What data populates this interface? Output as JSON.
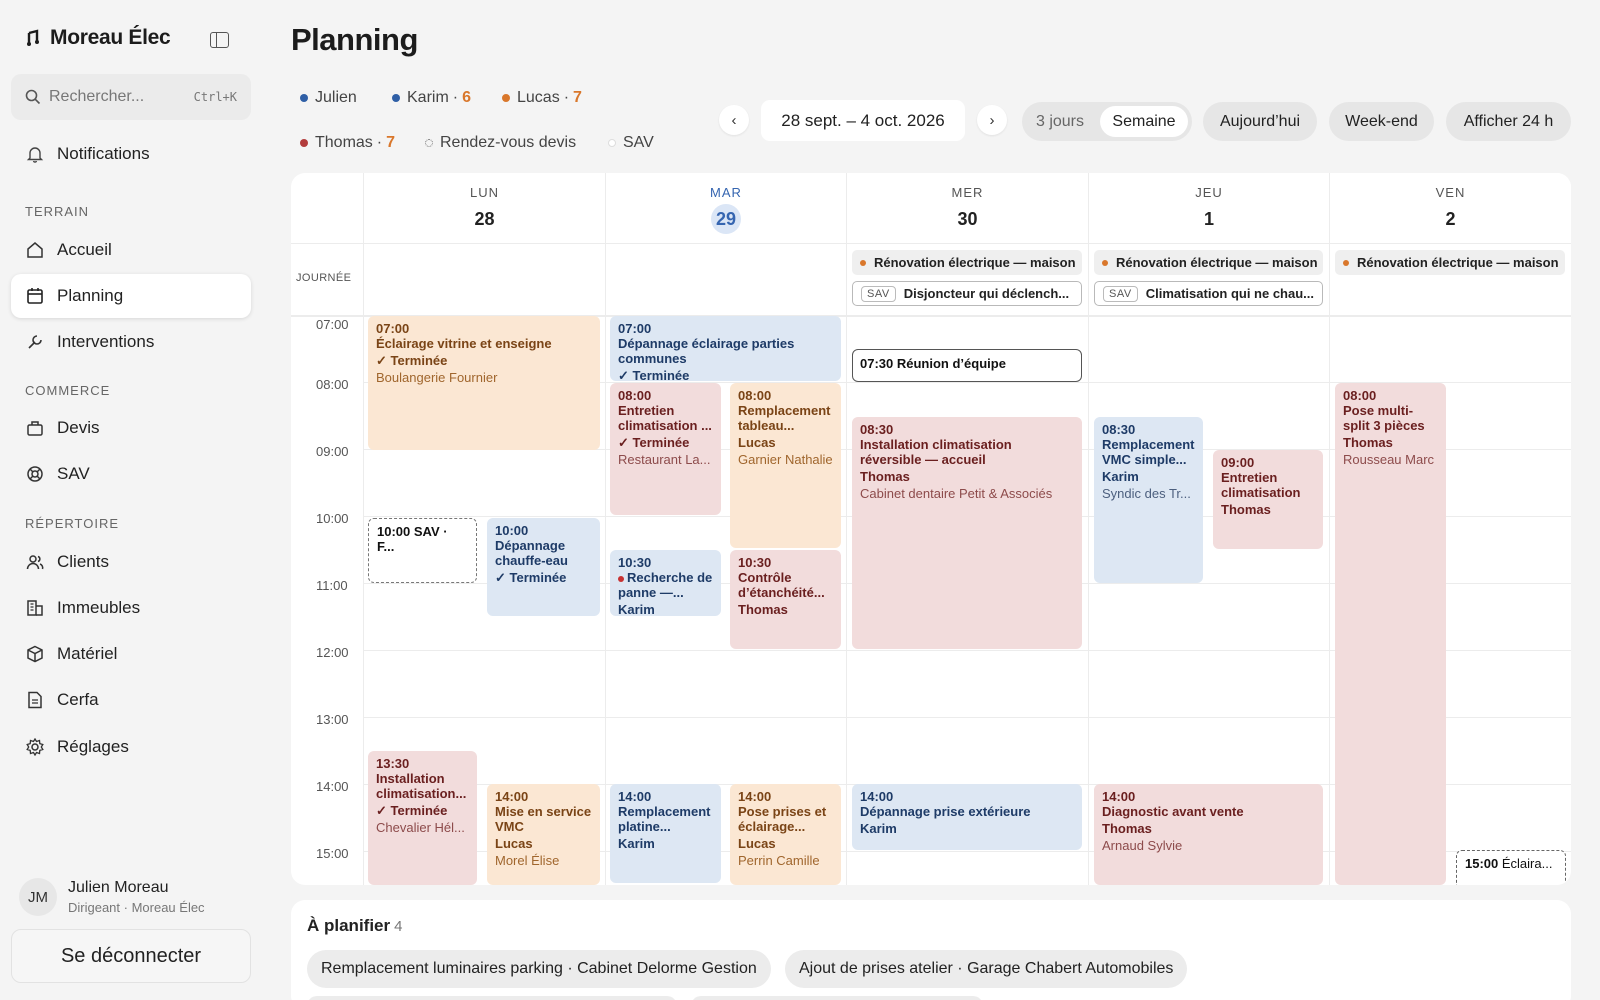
{
  "app": {
    "brand": "Moreau Élec"
  },
  "search": {
    "placeholder": "Rechercher...",
    "shortcut": "Ctrl+K"
  },
  "sidebar": {
    "notifications": "Notifications",
    "sections": {
      "terrain": "TERRAIN",
      "commerce": "COMMERCE",
      "repertoire": "RÉPERTOIRE"
    },
    "items": [
      {
        "label": "Accueil",
        "icon": "home-icon"
      },
      {
        "label": "Planning",
        "icon": "calendar-icon",
        "active": true
      },
      {
        "label": "Interventions",
        "icon": "wrench-icon"
      },
      {
        "label": "Devis",
        "icon": "briefcase-icon"
      },
      {
        "label": "SAV",
        "icon": "lifebuoy-icon"
      },
      {
        "label": "Clients",
        "icon": "users-icon"
      },
      {
        "label": "Immeubles",
        "icon": "building-icon"
      },
      {
        "label": "Matériel",
        "icon": "box-icon"
      },
      {
        "label": "Cerfa",
        "icon": "document-icon"
      },
      {
        "label": "Réglages",
        "icon": "gear-icon"
      }
    ]
  },
  "user": {
    "initials": "JM",
    "name": "Julien Moreau",
    "role": "Dirigeant · Moreau Élec",
    "logout": "Se déconnecter"
  },
  "header": {
    "title": "Planning"
  },
  "legend": [
    {
      "name": "Julien",
      "count": "",
      "color": "#2f5fa6"
    },
    {
      "name": "Karim",
      "count": "6",
      "color": "#2f5fa6"
    },
    {
      "name": "Lucas",
      "count": "7",
      "color": "#d9772b"
    },
    {
      "name": "Thomas",
      "count": "7",
      "color": "#b23c3c"
    },
    {
      "name": "Rendez-vous devis",
      "count": ""
    },
    {
      "name": "SAV",
      "count": ""
    }
  ],
  "toolbar": {
    "prev": "‹",
    "next": "›",
    "range": "28 sept. – 4 oct. 2026",
    "view_3days": "3 jours",
    "view_week": "Semaine",
    "today": "Aujourd’hui",
    "weekend": "Week-end",
    "show24": "Afficher 24 h"
  },
  "calendar": {
    "journee_label": "JOURNÉE",
    "days": [
      {
        "dow": "LUN",
        "num": "28"
      },
      {
        "dow": "MAR",
        "num": "29",
        "today": true
      },
      {
        "dow": "MER",
        "num": "30"
      },
      {
        "dow": "JEU",
        "num": "1"
      },
      {
        "dow": "VEN",
        "num": "2"
      }
    ],
    "hours": [
      "07:00",
      "08:00",
      "09:00",
      "10:00",
      "11:00",
      "12:00",
      "13:00",
      "14:00",
      "15:00"
    ],
    "allday": {
      "renovation": "Rénovation électrique — maison",
      "sav_tag": "SAV",
      "sav_wed": "Disjoncteur qui déclench...",
      "sav_thu": "Climatisation qui ne chau..."
    },
    "events": {
      "e1": {
        "time": "07:00",
        "title": "Éclairage vitrine et enseigne",
        "status": "✓ Terminée",
        "client": "Boulangerie Fournier"
      },
      "e2": {
        "time": "10:00",
        "title": "SAV · F..."
      },
      "e3": {
        "time": "10:00",
        "title": "Dépannage chauffe-eau",
        "status": "✓ Terminée"
      },
      "e4": {
        "time": "13:30",
        "title": "Installation climatisation...",
        "status": "✓ Terminée",
        "client": "Chevalier Hél..."
      },
      "e5": {
        "time": "14:00",
        "title": "Mise en service VMC",
        "who": "Lucas",
        "client": "Morel Élise"
      },
      "e6": {
        "time": "07:00",
        "title": "Dépannage éclairage parties communes",
        "status": "✓ Terminée"
      },
      "e7": {
        "time": "08:00",
        "title": "Entretien climatisation ...",
        "status": "✓ Terminée",
        "client": "Restaurant La..."
      },
      "e8": {
        "time": "08:00",
        "title": "Remplacement tableau...",
        "who": "Lucas",
        "client": "Garnier Nathalie"
      },
      "e9": {
        "time": "10:30",
        "title": "Recherche de panne —...",
        "who": "Karim"
      },
      "e10": {
        "time": "10:30",
        "title": "Contrôle d’étanchéité...",
        "who": "Thomas"
      },
      "e11": {
        "time": "14:00",
        "title": "Remplacement platine...",
        "who": "Karim"
      },
      "e12": {
        "time": "14:00",
        "title": "Pose prises et éclairage...",
        "who": "Lucas",
        "client": "Perrin Camille"
      },
      "e13": {
        "time": "07:30",
        "title": "Réunion d’équipe"
      },
      "e14": {
        "time": "08:30",
        "title": "Installation climatisation réversible — accueil",
        "who": "Thomas",
        "client": "Cabinet dentaire Petit & Associés"
      },
      "e15": {
        "time": "14:00",
        "title": "Dépannage prise extérieure",
        "who": "Karim"
      },
      "e16": {
        "time": "08:30",
        "title": "Remplacement VMC simple...",
        "who": "Karim",
        "client": "Syndic des Tr..."
      },
      "e17": {
        "time": "09:00",
        "title": "Entretien climatisation",
        "who": "Thomas"
      },
      "e18": {
        "time": "14:00",
        "title": "Diagnostic avant vente",
        "who": "Thomas",
        "client": "Arnaud Sylvie"
      },
      "e19": {
        "time": "08:00",
        "title": "Pose multi-split 3 pièces",
        "who": "Thomas",
        "client": "Rousseau Marc"
      },
      "e20": {
        "time": "15:00",
        "title": "Éclaira..."
      }
    }
  },
  "toplan": {
    "title": "À planifier",
    "count": "4",
    "items": [
      "Remplacement luminaires parking · Cabinet Delorme Gestion",
      "Ajout de prises atelier · Garage Chabert Automobiles"
    ]
  }
}
